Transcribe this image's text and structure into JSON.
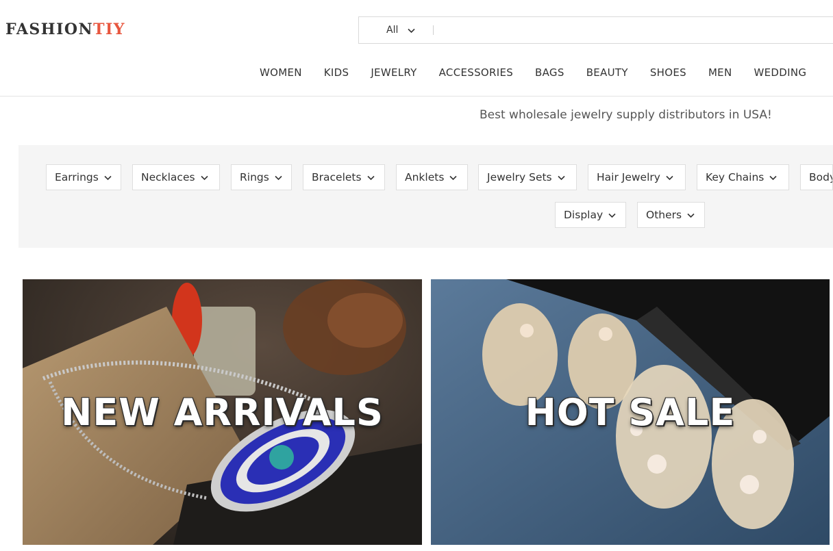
{
  "logo": {
    "part1": "FASHION",
    "part2": "TIY"
  },
  "search": {
    "scope": "All",
    "placeholder": ""
  },
  "nav": [
    "WOMEN",
    "KIDS",
    "JEWELRY",
    "ACCESSORIES",
    "BAGS",
    "BEAUTY",
    "SHOES",
    "MEN",
    "WEDDING"
  ],
  "tagline": "Best wholesale jewelry supply distributors in USA!",
  "categories": [
    "Earrings",
    "Necklaces",
    "Rings",
    "Bracelets",
    "Anklets",
    "Jewelry Sets",
    "Hair Jewelry",
    "Key Chains",
    "Body",
    "Display",
    "Others"
  ],
  "banners": {
    "left": "NEW ARRIVALS",
    "right": "HOT SALE"
  },
  "colors": {
    "accent": "#e8573f",
    "panel": "#f5f5f5"
  }
}
